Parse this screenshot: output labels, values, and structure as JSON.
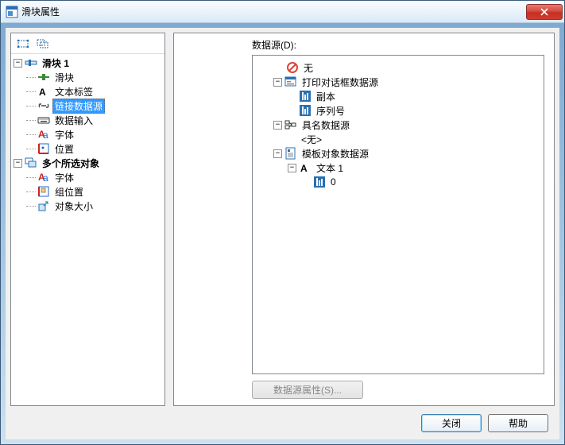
{
  "window": {
    "title": "滑块属性"
  },
  "left_tree": {
    "group1": {
      "label": "滑块 1",
      "items": {
        "slider": "滑块",
        "text_label": "文本标签",
        "link_ds": "链接数据源",
        "data_input": "数据输入",
        "font": "字体",
        "position": "位置"
      }
    },
    "group2": {
      "label": "多个所选对象",
      "items": {
        "font": "字体",
        "group_pos": "组位置",
        "obj_size": "对象大小"
      }
    }
  },
  "right": {
    "section": "数据源(D):",
    "tree": {
      "none": "无",
      "print_dlg": {
        "label": "打印对话框数据源",
        "copy": "副本",
        "serial": "序列号"
      },
      "named_ds": {
        "label": "具名数据源",
        "none_item": "<无>"
      },
      "template_obj": {
        "label": "模板对象数据源",
        "text1": {
          "label": "文本 1",
          "child0": "0"
        }
      }
    },
    "prop_btn": "数据源属性(S)..."
  },
  "footer": {
    "close": "关闭",
    "help": "帮助"
  }
}
